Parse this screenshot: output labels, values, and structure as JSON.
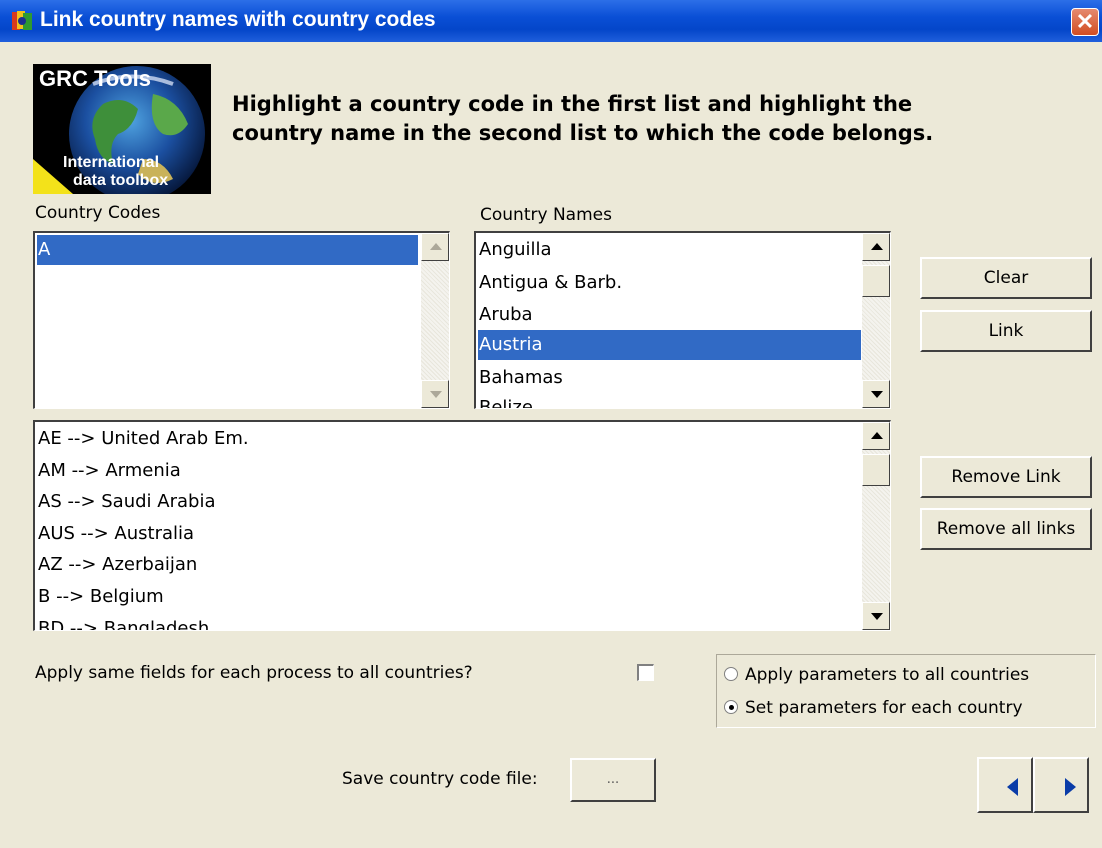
{
  "window": {
    "title": "Link country names with country codes",
    "close_label": "✕"
  },
  "logo": {
    "line1": "GRC Tools",
    "line2": "International",
    "line3": "data toolbox"
  },
  "instruction": "Highlight a country code in the first list and highlight the country name in the second list to which the code belongs.",
  "country_codes": {
    "label": "Country Codes",
    "items": [
      "A"
    ],
    "selected_index": 0
  },
  "country_names": {
    "label": "Country Names",
    "items": [
      "Anguilla",
      "Antigua & Barb.",
      "Aruba",
      "Austria",
      "Bahamas",
      "Belize"
    ],
    "selected_index": 3
  },
  "links": {
    "items": [
      "AE --> United Arab Em.",
      "AM --> Armenia",
      "AS --> Saudi Arabia",
      "AUS --> Australia",
      "AZ --> Azerbaijan",
      "B --> Belgium",
      "BD --> Bangladesh"
    ]
  },
  "buttons": {
    "clear": "Clear",
    "link": "Link",
    "remove_link": "Remove Link",
    "remove_all_links": "Remove all links",
    "save_file": "..."
  },
  "options": {
    "apply_same_fields_label": "Apply same fields for each process to all countries?",
    "apply_same_fields_checked": false,
    "radio_apply_all": "Apply parameters to all countries",
    "radio_each_country": "Set parameters for each country",
    "selected_radio": "each_country"
  },
  "save": {
    "label": "Save country code file:"
  },
  "nav": {
    "prev_icon": "arrow-left-icon",
    "next_icon": "arrow-right-icon"
  },
  "colors": {
    "title_bar": "#0a4fd6",
    "selection": "#316ac5",
    "window_bg": "#ece9d8",
    "close_button": "#d24d22"
  }
}
